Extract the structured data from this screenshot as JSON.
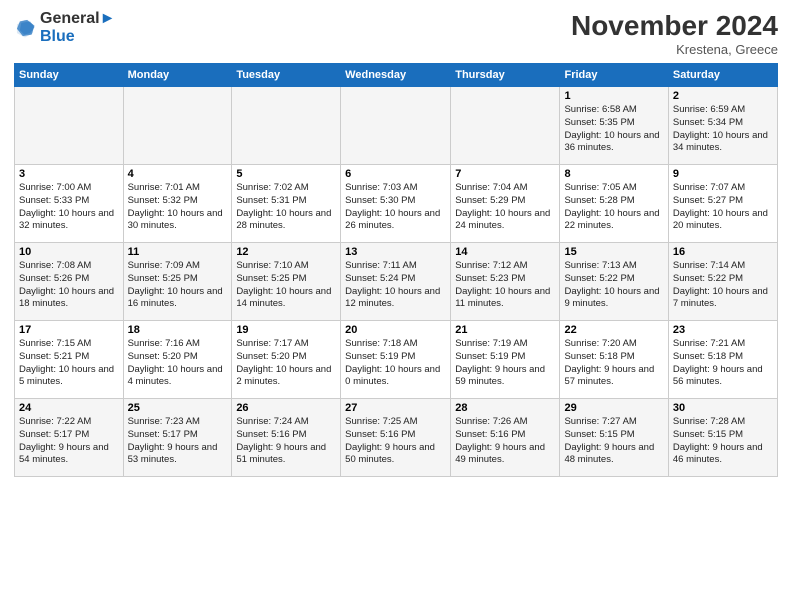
{
  "logo": {
    "line1": "General",
    "line2": "Blue"
  },
  "title": "November 2024",
  "location": "Krestena, Greece",
  "days_of_week": [
    "Sunday",
    "Monday",
    "Tuesday",
    "Wednesday",
    "Thursday",
    "Friday",
    "Saturday"
  ],
  "weeks": [
    [
      {
        "day": "",
        "info": ""
      },
      {
        "day": "",
        "info": ""
      },
      {
        "day": "",
        "info": ""
      },
      {
        "day": "",
        "info": ""
      },
      {
        "day": "",
        "info": ""
      },
      {
        "day": "1",
        "info": "Sunrise: 6:58 AM\nSunset: 5:35 PM\nDaylight: 10 hours\nand 36 minutes."
      },
      {
        "day": "2",
        "info": "Sunrise: 6:59 AM\nSunset: 5:34 PM\nDaylight: 10 hours\nand 34 minutes."
      }
    ],
    [
      {
        "day": "3",
        "info": "Sunrise: 7:00 AM\nSunset: 5:33 PM\nDaylight: 10 hours\nand 32 minutes."
      },
      {
        "day": "4",
        "info": "Sunrise: 7:01 AM\nSunset: 5:32 PM\nDaylight: 10 hours\nand 30 minutes."
      },
      {
        "day": "5",
        "info": "Sunrise: 7:02 AM\nSunset: 5:31 PM\nDaylight: 10 hours\nand 28 minutes."
      },
      {
        "day": "6",
        "info": "Sunrise: 7:03 AM\nSunset: 5:30 PM\nDaylight: 10 hours\nand 26 minutes."
      },
      {
        "day": "7",
        "info": "Sunrise: 7:04 AM\nSunset: 5:29 PM\nDaylight: 10 hours\nand 24 minutes."
      },
      {
        "day": "8",
        "info": "Sunrise: 7:05 AM\nSunset: 5:28 PM\nDaylight: 10 hours\nand 22 minutes."
      },
      {
        "day": "9",
        "info": "Sunrise: 7:07 AM\nSunset: 5:27 PM\nDaylight: 10 hours\nand 20 minutes."
      }
    ],
    [
      {
        "day": "10",
        "info": "Sunrise: 7:08 AM\nSunset: 5:26 PM\nDaylight: 10 hours\nand 18 minutes."
      },
      {
        "day": "11",
        "info": "Sunrise: 7:09 AM\nSunset: 5:25 PM\nDaylight: 10 hours\nand 16 minutes."
      },
      {
        "day": "12",
        "info": "Sunrise: 7:10 AM\nSunset: 5:25 PM\nDaylight: 10 hours\nand 14 minutes."
      },
      {
        "day": "13",
        "info": "Sunrise: 7:11 AM\nSunset: 5:24 PM\nDaylight: 10 hours\nand 12 minutes."
      },
      {
        "day": "14",
        "info": "Sunrise: 7:12 AM\nSunset: 5:23 PM\nDaylight: 10 hours\nand 11 minutes."
      },
      {
        "day": "15",
        "info": "Sunrise: 7:13 AM\nSunset: 5:22 PM\nDaylight: 10 hours\nand 9 minutes."
      },
      {
        "day": "16",
        "info": "Sunrise: 7:14 AM\nSunset: 5:22 PM\nDaylight: 10 hours\nand 7 minutes."
      }
    ],
    [
      {
        "day": "17",
        "info": "Sunrise: 7:15 AM\nSunset: 5:21 PM\nDaylight: 10 hours\nand 5 minutes."
      },
      {
        "day": "18",
        "info": "Sunrise: 7:16 AM\nSunset: 5:20 PM\nDaylight: 10 hours\nand 4 minutes."
      },
      {
        "day": "19",
        "info": "Sunrise: 7:17 AM\nSunset: 5:20 PM\nDaylight: 10 hours\nand 2 minutes."
      },
      {
        "day": "20",
        "info": "Sunrise: 7:18 AM\nSunset: 5:19 PM\nDaylight: 10 hours\nand 0 minutes."
      },
      {
        "day": "21",
        "info": "Sunrise: 7:19 AM\nSunset: 5:19 PM\nDaylight: 9 hours\nand 59 minutes."
      },
      {
        "day": "22",
        "info": "Sunrise: 7:20 AM\nSunset: 5:18 PM\nDaylight: 9 hours\nand 57 minutes."
      },
      {
        "day": "23",
        "info": "Sunrise: 7:21 AM\nSunset: 5:18 PM\nDaylight: 9 hours\nand 56 minutes."
      }
    ],
    [
      {
        "day": "24",
        "info": "Sunrise: 7:22 AM\nSunset: 5:17 PM\nDaylight: 9 hours\nand 54 minutes."
      },
      {
        "day": "25",
        "info": "Sunrise: 7:23 AM\nSunset: 5:17 PM\nDaylight: 9 hours\nand 53 minutes."
      },
      {
        "day": "26",
        "info": "Sunrise: 7:24 AM\nSunset: 5:16 PM\nDaylight: 9 hours\nand 51 minutes."
      },
      {
        "day": "27",
        "info": "Sunrise: 7:25 AM\nSunset: 5:16 PM\nDaylight: 9 hours\nand 50 minutes."
      },
      {
        "day": "28",
        "info": "Sunrise: 7:26 AM\nSunset: 5:16 PM\nDaylight: 9 hours\nand 49 minutes."
      },
      {
        "day": "29",
        "info": "Sunrise: 7:27 AM\nSunset: 5:15 PM\nDaylight: 9 hours\nand 48 minutes."
      },
      {
        "day": "30",
        "info": "Sunrise: 7:28 AM\nSunset: 5:15 PM\nDaylight: 9 hours\nand 46 minutes."
      }
    ]
  ]
}
